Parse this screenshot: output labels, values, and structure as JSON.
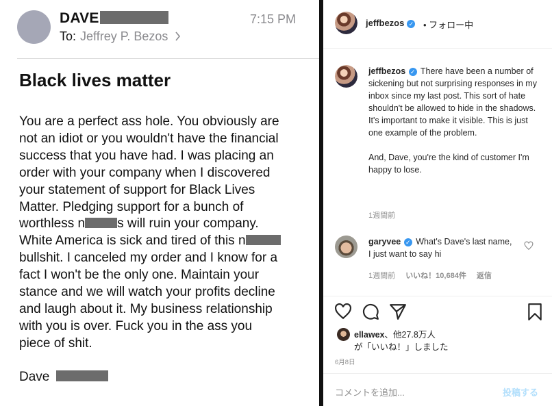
{
  "email": {
    "sender_name": "DAVE",
    "to_label": "To:",
    "recipient": "Jeffrey P. Bezos",
    "chevron_icon": "chevron-right-icon",
    "time": "7:15 PM",
    "subject": "Black lives matter",
    "body_lines": [
      "You are a perfect ass hole. You obviously are",
      "not an idiot or you wouldn't have the financial",
      "success that you have had. I was placing an",
      "order with your company when I discovered",
      "your statement of support for Black Lives",
      "Matter. Pledging support for a bunch of",
      "worthless n",
      "s will ruin your company.",
      "White America is sick and tired of this n",
      "bullshit. I canceled my order and I know for a",
      "fact I won't be the only one. Maintain your",
      "stance and we will watch your profits decline",
      "and laugh about it. My business relationship",
      "with you is over. Fuck you in the ass you",
      "piece of shit."
    ],
    "signature": "Dave"
  },
  "instagram": {
    "header": {
      "username": "jeffbezos",
      "verified_icon": "verified-badge-icon",
      "follow_status": "• フォロー中"
    },
    "caption": {
      "username": "jeffbezos",
      "paragraph1": "There have been a number of sickening but not surprising responses in my inbox since my last post. This sort of hate shouldn't be allowed to hide in the shadows. It's important to make it visible. This is just one example of the problem.",
      "paragraph2": "And, Dave, you're the kind of customer I'm happy to lose.",
      "time": "1週間前"
    },
    "comment": {
      "username": "garyvee",
      "text": "What's Dave's last name, I just want to say hi",
      "time": "1週間前",
      "likes": "いいね！10,684件",
      "reply": "返信"
    },
    "actions": {
      "like_icon": "heart-icon",
      "comment_icon": "comment-icon",
      "share_icon": "share-icon",
      "save_icon": "bookmark-icon"
    },
    "likes": {
      "line1_user": "ellawex",
      "line1_rest": "、他27.8万人",
      "line2": "が「いいね！」しました"
    },
    "post_date": "6月8日",
    "comment_placeholder": "コメントを追加...",
    "post_button": "投稿する"
  }
}
